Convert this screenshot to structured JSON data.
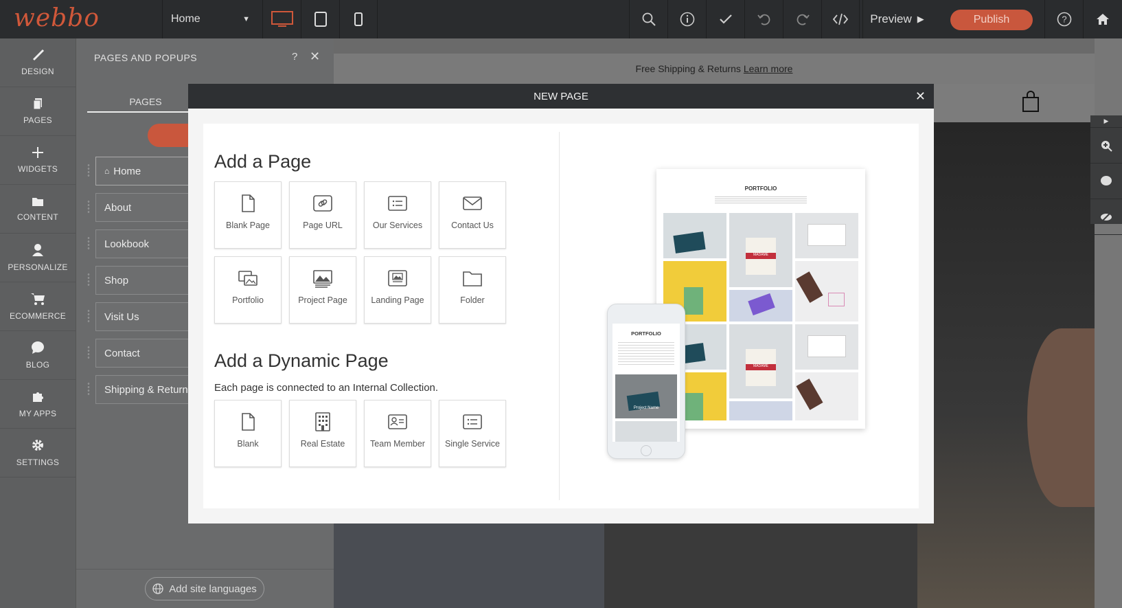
{
  "app": {
    "logo": "webbo"
  },
  "topbar": {
    "page_select": "Home",
    "preview_label": "Preview",
    "publish_label": "Publish"
  },
  "leftnav": {
    "items": [
      {
        "label": "DESIGN",
        "icon": "brush-icon"
      },
      {
        "label": "PAGES",
        "icon": "pages-icon"
      },
      {
        "label": "WIDGETS",
        "icon": "plus-icon"
      },
      {
        "label": "CONTENT",
        "icon": "folder-icon"
      },
      {
        "label": "PERSONALIZE",
        "icon": "person-icon"
      },
      {
        "label": "ECOMMERCE",
        "icon": "cart-icon"
      },
      {
        "label": "BLOG",
        "icon": "chat-icon"
      },
      {
        "label": "MY APPS",
        "icon": "puzzle-icon"
      },
      {
        "label": "SETTINGS",
        "icon": "gear-icon"
      }
    ]
  },
  "panel": {
    "title": "PAGES AND POPUPS",
    "help": "?",
    "tab": "PAGES",
    "pages": [
      "Home",
      "About",
      "Lookbook",
      "Shop",
      "Visit Us",
      "Contact",
      "Shipping & Returns"
    ],
    "languages_button": "Add site languages"
  },
  "site": {
    "banner_text": "Free Shipping & Returns",
    "banner_link": "Learn more"
  },
  "modal": {
    "title": "NEW PAGE",
    "add_page_heading": "Add a Page",
    "page_tiles": [
      "Blank Page",
      "Page URL",
      "Our Services",
      "Contact Us",
      "Portfolio",
      "Project Page",
      "Landing Page",
      "Folder"
    ],
    "dynamic_heading": "Add a Dynamic Page",
    "dynamic_desc": "Each page is connected to an Internal Collection.",
    "dynamic_tiles": [
      "Blank",
      "Real Estate",
      "Team Member",
      "Single Service"
    ],
    "preview": {
      "desktop_title": "PORTFOLIO",
      "mobile_title": "PORTFOLIO",
      "bag_label_1": "MADAME",
      "bag_label_2": "MADAME",
      "mobile_caption": "Project Name"
    }
  },
  "colors": {
    "accent": "#c9573d",
    "topbar": "#2a2c2e",
    "modal_header": "#2e3033"
  }
}
